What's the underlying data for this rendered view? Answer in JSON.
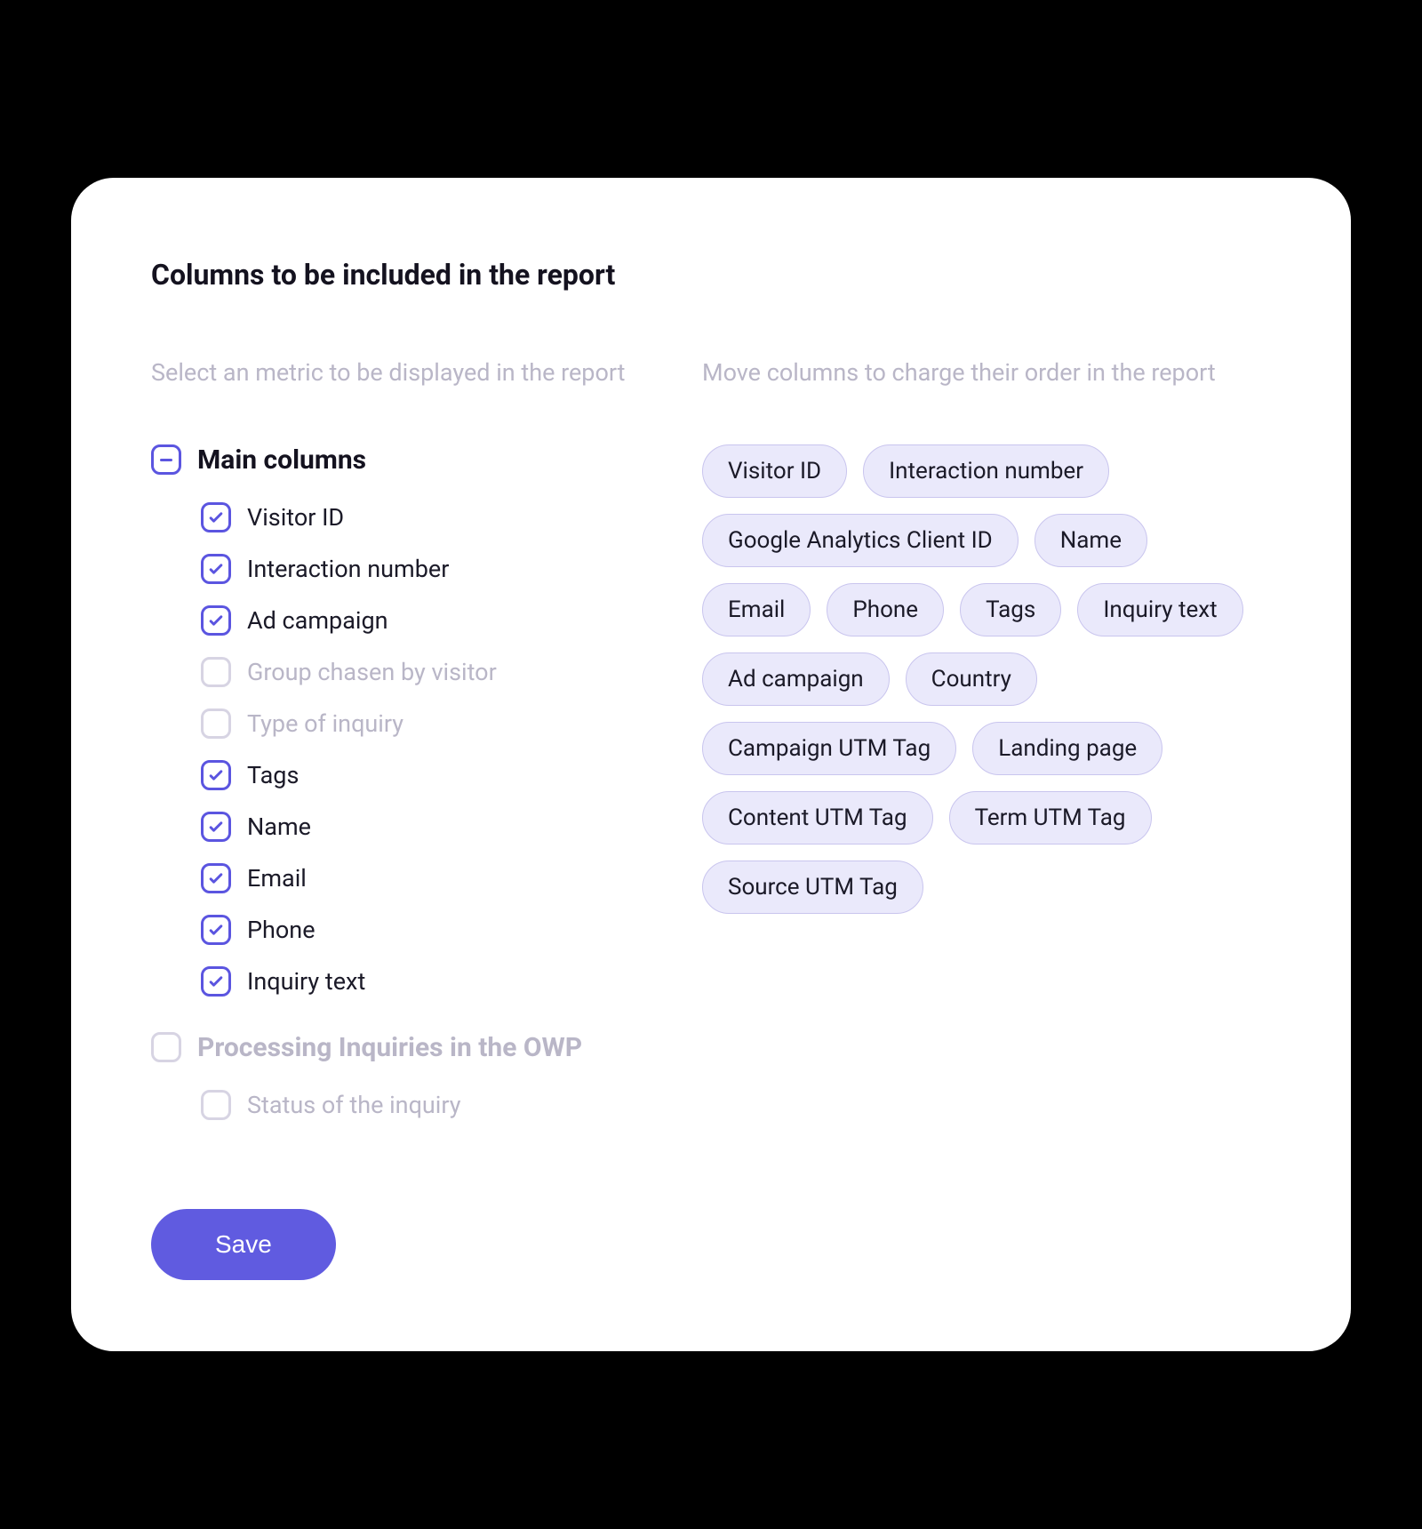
{
  "title": "Columns to be included in the report",
  "left": {
    "hint": "Select an metric to be displayed in the report",
    "groups": [
      {
        "key": "main",
        "label": "Main columns",
        "state": "indeterminate",
        "muted": false,
        "items": [
          {
            "label": "Visitor ID",
            "checked": true
          },
          {
            "label": "Interaction number",
            "checked": true
          },
          {
            "label": "Ad campaign",
            "checked": true
          },
          {
            "label": "Group chasen by visitor",
            "checked": false
          },
          {
            "label": "Type of inquiry",
            "checked": false
          },
          {
            "label": "Tags",
            "checked": true
          },
          {
            "label": "Name",
            "checked": true
          },
          {
            "label": "Email",
            "checked": true
          },
          {
            "label": "Phone",
            "checked": true
          },
          {
            "label": "Inquiry text",
            "checked": true
          }
        ]
      },
      {
        "key": "owp",
        "label": "Processing Inquiries in the OWP",
        "state": "unchecked",
        "muted": true,
        "items": [
          {
            "label": "Status of the inquiry",
            "checked": false
          }
        ]
      }
    ]
  },
  "right": {
    "hint": "Move columns to charge their order in the report",
    "chips": [
      "Visitor ID",
      "Interaction number",
      "Google Analytics Client ID",
      "Name",
      "Email",
      "Phone",
      "Tags",
      "Inquiry text",
      "Ad campaign",
      "Country",
      "Campaign UTM Tag",
      "Landing page",
      "Content UTM Tag",
      "Term UTM Tag",
      "Source UTM Tag"
    ]
  },
  "actions": {
    "save": "Save"
  }
}
